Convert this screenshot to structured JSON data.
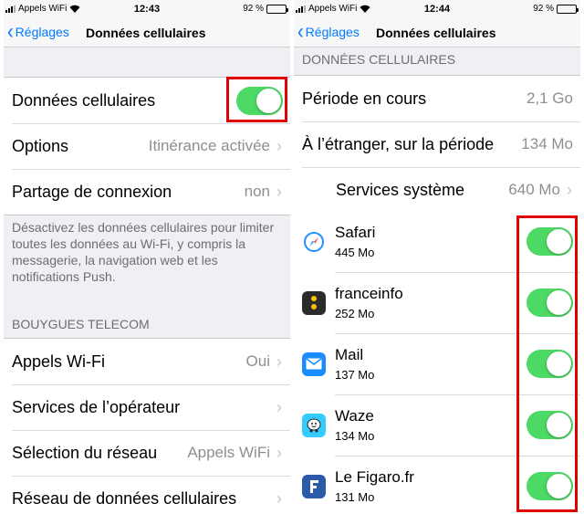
{
  "left": {
    "status": {
      "carrier": "Appels WiFi",
      "time": "12:43",
      "battery": "92 %"
    },
    "nav": {
      "back_label": "Réglages",
      "title": "Données cellulaires"
    },
    "cellular_label": "Données cellulaires",
    "options": {
      "label": "Options",
      "value": "Itinérance activée"
    },
    "hotspot": {
      "label": "Partage de connexion",
      "value": "non"
    },
    "note": "Désactivez les données cellulaires pour limiter toutes les données au Wi-Fi, y compris la messagerie, la navigation web et les notifications Push.",
    "section": "BOUYGUES TELECOM",
    "wifi_calls": {
      "label": "Appels Wi-Fi",
      "value": "Oui"
    },
    "operator_services": {
      "label": "Services de l’opérateur"
    },
    "network_selection": {
      "label": "Sélection du réseau",
      "value": "Appels WiFi"
    },
    "data_network": {
      "label": "Réseau de données cellulaires"
    }
  },
  "right": {
    "status": {
      "carrier": "Appels WiFi",
      "time": "12:44",
      "battery": "92 %"
    },
    "nav": {
      "back_label": "Réglages",
      "title": "Données cellulaires"
    },
    "section": "DONNÉES CELLULAIRES",
    "current_period": {
      "label": "Période en cours",
      "value": "2,1 Go"
    },
    "roaming_period": {
      "label": "À l’étranger, sur la période",
      "value": "134 Mo"
    },
    "system_services": {
      "label": "Services système",
      "value": "640 Mo"
    },
    "apps": [
      {
        "name": "Safari",
        "size": "445 Mo",
        "icon": "safari-icon",
        "enabled": true
      },
      {
        "name": "franceinfo",
        "size": "252 Mo",
        "icon": "franceinfo-icon",
        "enabled": true
      },
      {
        "name": "Mail",
        "size": "137 Mo",
        "icon": "mail-icon",
        "enabled": true
      },
      {
        "name": "Waze",
        "size": "134 Mo",
        "icon": "waze-icon",
        "enabled": true
      },
      {
        "name": "Le Figaro.fr",
        "size": "131 Mo",
        "icon": "figaro-icon",
        "enabled": true
      }
    ]
  },
  "colors": {
    "toggle_on": "#4cd964",
    "ios_blue": "#007aff",
    "highlight": "#e00000",
    "franceinfo": "#2b2b2b",
    "mail": "#1a8cff",
    "waze": "#33ccff",
    "figaro": "#2a5aa8"
  }
}
